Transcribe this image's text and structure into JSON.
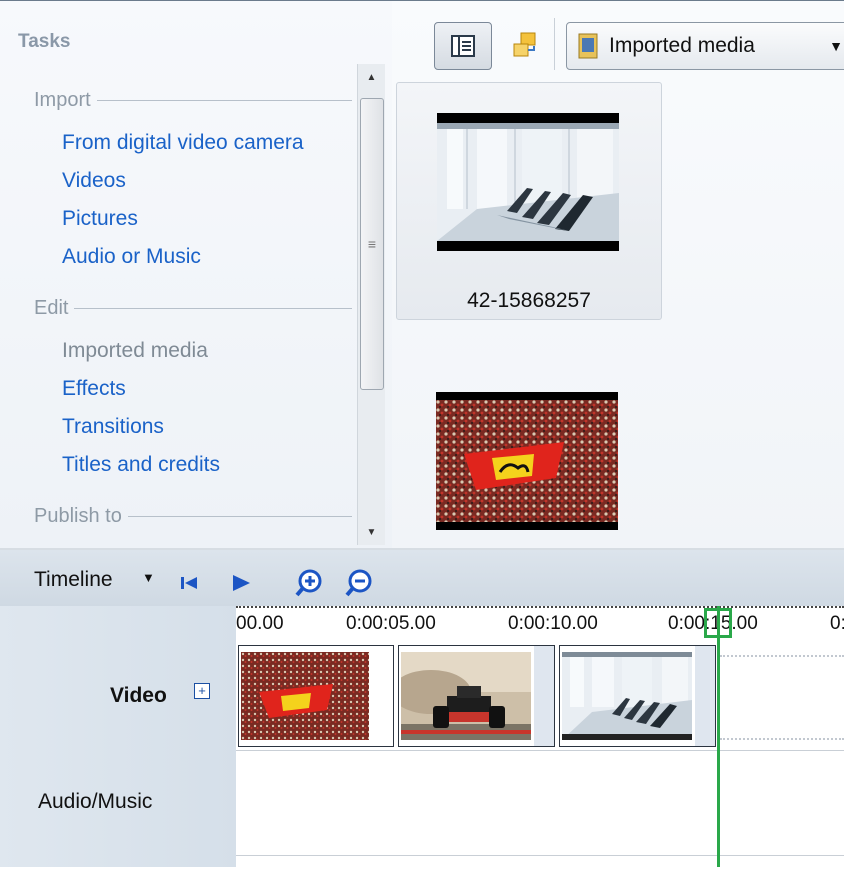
{
  "tasks": {
    "title": "Tasks",
    "sections": [
      {
        "header": "Import",
        "items": [
          "From digital video camera",
          "Videos",
          "Pictures",
          "Audio or Music"
        ]
      },
      {
        "header": "Edit",
        "items": [
          "Imported media",
          "Effects",
          "Transitions",
          "Titles and credits"
        ]
      },
      {
        "header": "Publish to",
        "items": []
      }
    ]
  },
  "media_toolbar": {
    "view_icon": "details-view-icon",
    "arrange_icon": "arrange-items-icon",
    "dropdown_selected": "Imported media"
  },
  "media_items": [
    {
      "caption": "42-15868257",
      "thumb": "office-laptops-thumbnail",
      "selected": true
    },
    {
      "caption": "",
      "thumb": "ferrari-flag-crowd-thumbnail",
      "selected": false
    }
  ],
  "timeline": {
    "label": "Timeline",
    "ruler": [
      "00.00",
      "0:00:05.00",
      "0:00:10.00",
      "0:00:15.00",
      "0:"
    ],
    "tracks": {
      "video": "Video",
      "audio": "Audio/Music"
    },
    "clips": [
      {
        "thumb": "ferrari-flag-crowd-clip"
      },
      {
        "thumb": "race-car-clip"
      },
      {
        "thumb": "office-laptops-clip"
      }
    ],
    "playhead_color": "#2aa84a"
  },
  "colors": {
    "link": "#1a62c8",
    "muted": "#8e9aa6"
  }
}
